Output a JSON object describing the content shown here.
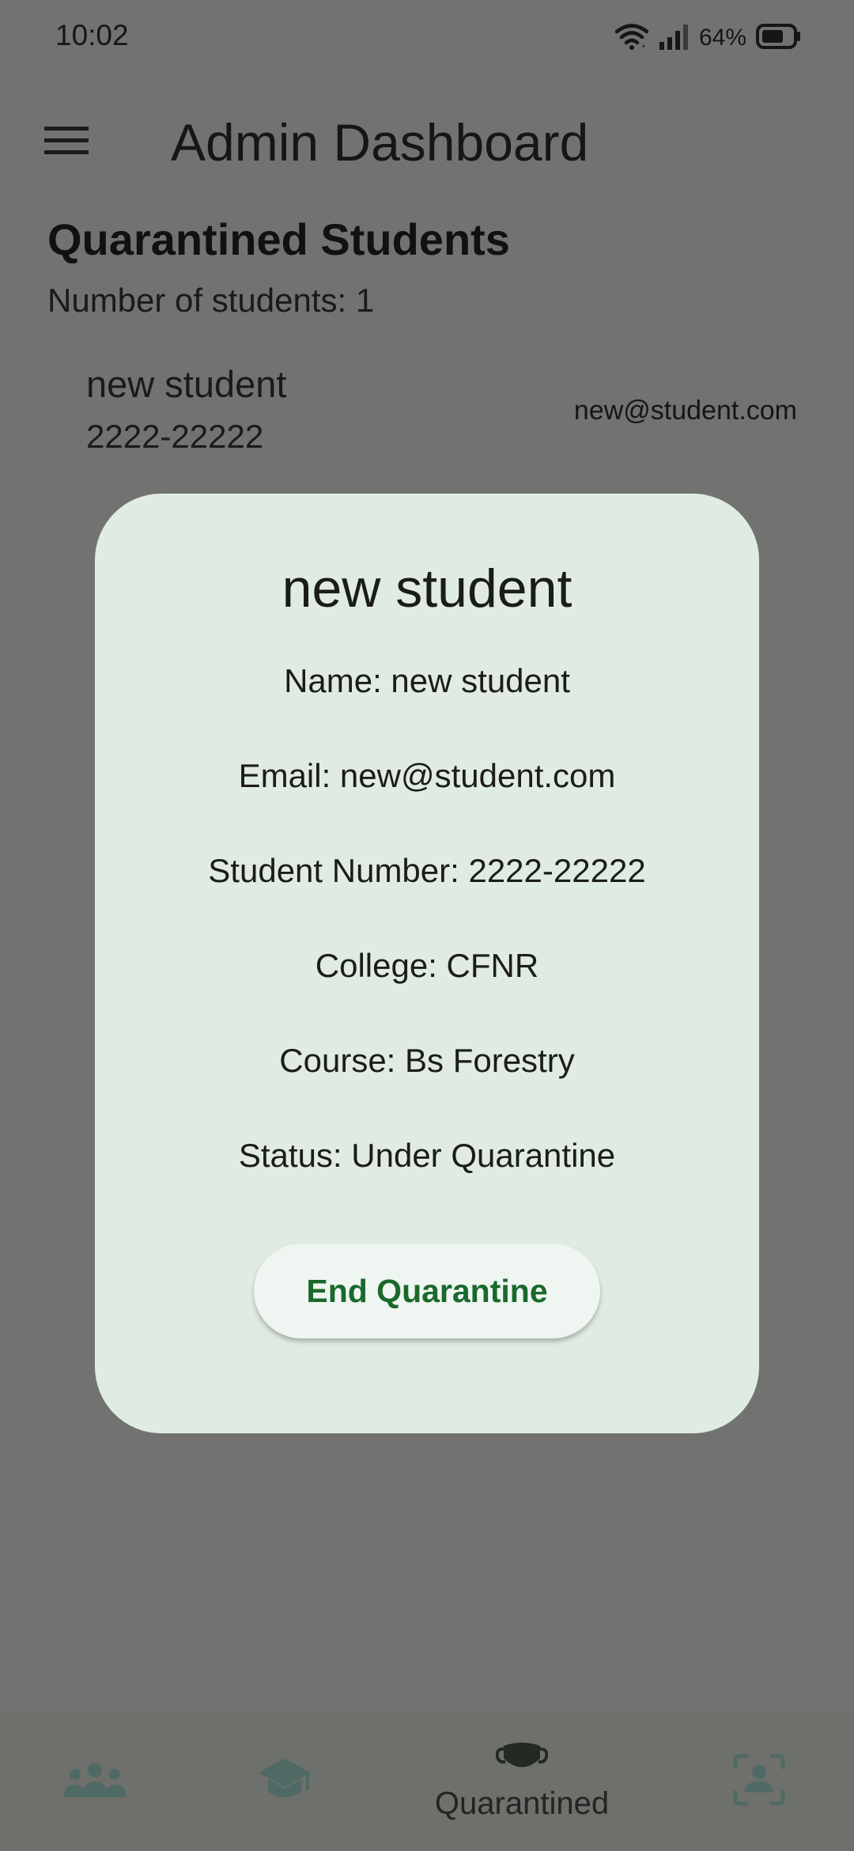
{
  "status_bar": {
    "time": "10:02",
    "battery_percent": "64%",
    "icons": [
      "wifi-icon",
      "signal-icon",
      "battery-icon"
    ]
  },
  "app_bar": {
    "title": "Admin Dashboard",
    "menu_icon": "menu-icon"
  },
  "page": {
    "heading": "Quarantined Students",
    "count_text": "Number of students: 1",
    "students": [
      {
        "name": "new student",
        "number": "2222-22222",
        "email": "new@student.com"
      }
    ]
  },
  "dialog": {
    "title": "new student",
    "lines": {
      "name": "Name: new student",
      "email": "Email: new@student.com",
      "student_number": "Student Number: 2222-22222",
      "college": "College: CFNR",
      "course": "Course: Bs Forestry",
      "status": "Status: Under Quarantine"
    },
    "button_label": "End Quarantine"
  },
  "bottom_nav": {
    "items": [
      {
        "icon": "people-group-icon",
        "label": "",
        "active": false
      },
      {
        "icon": "graduation-cap-icon",
        "label": "",
        "active": false
      },
      {
        "icon": "face-mask-icon",
        "label": "Quarantined",
        "active": true
      },
      {
        "icon": "face-scan-icon",
        "label": "",
        "active": false
      }
    ]
  },
  "colors": {
    "scrim_background": "#727370",
    "dialog_background": "#e0ece2",
    "accent_green": "#19692c",
    "inactive_nav_icon": "#4f6a64"
  }
}
